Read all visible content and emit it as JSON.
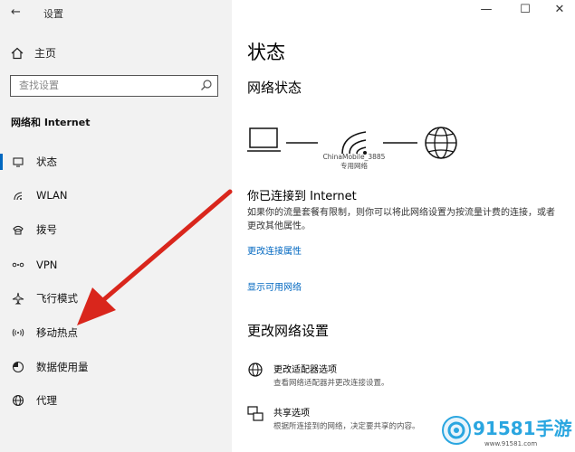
{
  "window": {
    "back_glyph": "←",
    "title": "设置",
    "minimize_glyph": "—",
    "maximize_glyph": "☐",
    "close_glyph": "✕"
  },
  "sidebar": {
    "home_label": "主页",
    "search_placeholder": "查找设置",
    "category": "网络和 Internet",
    "items": [
      {
        "label": "状态",
        "icon": "status-icon"
      },
      {
        "label": "WLAN",
        "icon": "wifi-icon"
      },
      {
        "label": "拨号",
        "icon": "dialup-icon"
      },
      {
        "label": "VPN",
        "icon": "vpn-icon"
      },
      {
        "label": "飞行模式",
        "icon": "airplane-icon"
      },
      {
        "label": "移动热点",
        "icon": "hotspot-icon"
      },
      {
        "label": "数据使用量",
        "icon": "data-usage-icon"
      },
      {
        "label": "代理",
        "icon": "globe-icon"
      }
    ]
  },
  "main": {
    "title": "状态",
    "network_status_heading": "网络状态",
    "network_name": "ChinaMobile_3885",
    "network_type": "专用网络",
    "connected_text": "你已连接到 Internet",
    "description": "如果你的流量套餐有限制，则你可以将此网络设置为按流量计费的连接，或者更改其他属性。",
    "link_change_props": "更改连接属性",
    "link_show_networks": "显示可用网络",
    "change_settings_heading": "更改网络设置",
    "options": [
      {
        "title": "更改适配器选项",
        "subtitle": "查看网络适配器并更改连接设置。",
        "icon": "adapter-icon"
      },
      {
        "title": "共享选项",
        "subtitle": "根据所连接到的网络，决定要共享的内容。",
        "icon": "sharing-icon"
      }
    ]
  },
  "watermark": {
    "brand": "91581手游",
    "url": "www.91581.com"
  },
  "colors": {
    "accent": "#0067c0",
    "arrow": "#d9261c",
    "watermark": "#2aa6e0"
  }
}
